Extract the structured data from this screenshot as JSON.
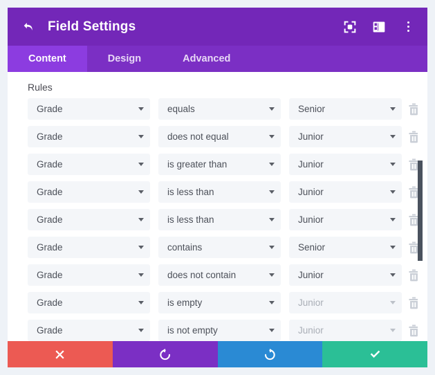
{
  "header": {
    "title": "Field Settings",
    "back_icon": "back-arrow-icon",
    "actions": [
      {
        "name": "focus-icon"
      },
      {
        "name": "layout-panel-icon"
      },
      {
        "name": "more-options-icon"
      }
    ]
  },
  "tabs": [
    {
      "label": "Content",
      "active": true
    },
    {
      "label": "Design",
      "active": false
    },
    {
      "label": "Advanced",
      "active": false
    }
  ],
  "main": {
    "section_title": "Rules",
    "rules": [
      {
        "field": "Grade",
        "operator": "equals",
        "value": "Senior",
        "value_disabled": false
      },
      {
        "field": "Grade",
        "operator": "does not equal",
        "value": "Junior",
        "value_disabled": false
      },
      {
        "field": "Grade",
        "operator": "is greater than",
        "value": "Junior",
        "value_disabled": false
      },
      {
        "field": "Grade",
        "operator": "is less than",
        "value": "Junior",
        "value_disabled": false
      },
      {
        "field": "Grade",
        "operator": "is less than",
        "value": "Junior",
        "value_disabled": false
      },
      {
        "field": "Grade",
        "operator": "contains",
        "value": "Senior",
        "value_disabled": false
      },
      {
        "field": "Grade",
        "operator": "does not contain",
        "value": "Junior",
        "value_disabled": false
      },
      {
        "field": "Grade",
        "operator": "is empty",
        "value": "Junior",
        "value_disabled": true
      },
      {
        "field": "Grade",
        "operator": "is not empty",
        "value": "Junior",
        "value_disabled": true
      }
    ],
    "delete_icon": "trash-icon"
  },
  "footer": {
    "buttons": [
      {
        "name": "cancel-button",
        "icon": "close-icon"
      },
      {
        "name": "undo-button",
        "icon": "undo-icon"
      },
      {
        "name": "redo-button",
        "icon": "redo-icon"
      },
      {
        "name": "save-button",
        "icon": "check-icon"
      }
    ]
  },
  "colors": {
    "header_purple": "#7327b8",
    "tab_bar_purple": "#7b2fc4",
    "tab_active_purple": "#8c3ce0",
    "cancel_red": "#ec5a53",
    "undo_purple": "#7b2fc4",
    "redo_blue": "#2a8ad4",
    "save_green": "#2bbf96",
    "field_bg": "#f4f6f9",
    "page_bg": "#eef2f7"
  }
}
